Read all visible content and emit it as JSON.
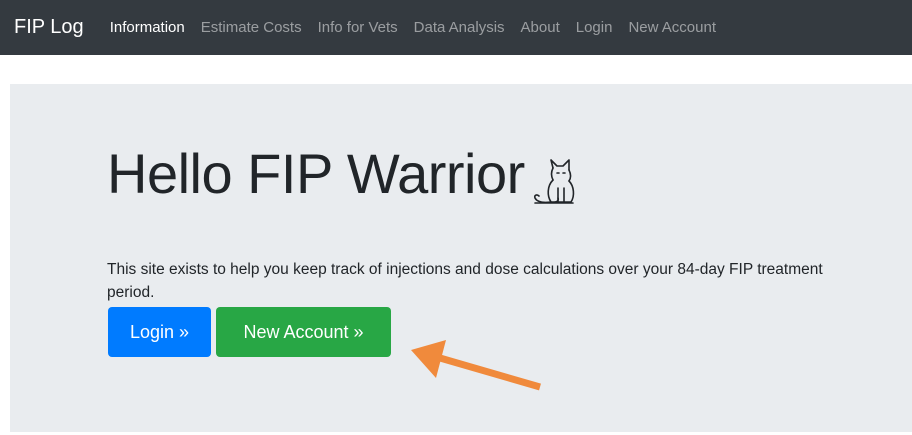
{
  "navbar": {
    "brand": "FIP Log",
    "links": [
      {
        "label": "Information",
        "active": true
      },
      {
        "label": "Estimate Costs",
        "active": false
      },
      {
        "label": "Info for Vets",
        "active": false
      },
      {
        "label": "Data Analysis",
        "active": false
      },
      {
        "label": "About",
        "active": false
      },
      {
        "label": "Login",
        "active": false
      },
      {
        "label": "New Account",
        "active": false
      }
    ]
  },
  "hero": {
    "title": "Hello FIP Warrior",
    "icon": "cat-icon",
    "lead": "This site exists to help you keep track of injections and dose calculations over your 84-day FIP treatment period.",
    "buttons": {
      "login_label": "Login »",
      "new_account_label": "New Account »"
    }
  },
  "annotation": {
    "arrow_color": "#f08a3c"
  },
  "colors": {
    "navbar_bg": "#343a40",
    "jumbotron_bg": "#e9ecef",
    "primary": "#007bff",
    "success": "#28a745"
  }
}
